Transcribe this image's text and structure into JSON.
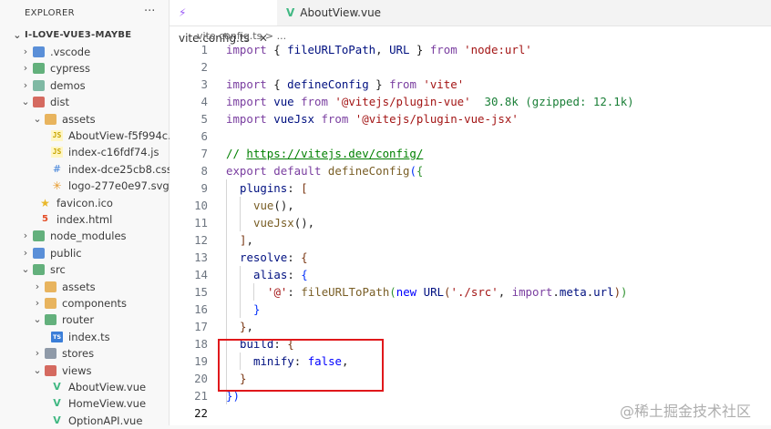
{
  "explorer": {
    "title": "EXPLORER",
    "more": "···",
    "root": "I-LOVE-VUE3-MAYBE",
    "items": [
      {
        "label": ".vscode",
        "type": "folder",
        "color": "blue",
        "chev": "›"
      },
      {
        "label": "cypress",
        "type": "folder",
        "color": "green",
        "chev": "›"
      },
      {
        "label": "demos",
        "type": "folder",
        "color": "teal",
        "chev": "›"
      },
      {
        "label": "dist",
        "type": "folder",
        "color": "red",
        "chev": "⌄"
      },
      {
        "label": "assets",
        "type": "folder",
        "color": "yellow",
        "chev": "⌄"
      },
      {
        "label": "AboutView-f5f994c...",
        "type": "js"
      },
      {
        "label": "index-c16fdf74.js",
        "type": "js"
      },
      {
        "label": "index-dce25cb8.css",
        "type": "css"
      },
      {
        "label": "logo-277e0e97.svg",
        "type": "svg"
      },
      {
        "label": "favicon.ico",
        "type": "ico"
      },
      {
        "label": "index.html",
        "type": "html"
      },
      {
        "label": "node_modules",
        "type": "folder",
        "color": "green",
        "chev": "›"
      },
      {
        "label": "public",
        "type": "folder",
        "color": "blue",
        "chev": "›"
      },
      {
        "label": "src",
        "type": "folder",
        "color": "green",
        "chev": "⌄"
      },
      {
        "label": "assets",
        "type": "folder",
        "color": "yellow",
        "chev": "›"
      },
      {
        "label": "components",
        "type": "folder",
        "color": "yellow",
        "chev": "›"
      },
      {
        "label": "router",
        "type": "folder",
        "color": "green",
        "chev": "⌄"
      },
      {
        "label": "index.ts",
        "type": "ts"
      },
      {
        "label": "stores",
        "type": "folder",
        "color": "grey",
        "chev": "›"
      },
      {
        "label": "views",
        "type": "folder",
        "color": "red",
        "chev": "⌄"
      },
      {
        "label": "AboutView.vue",
        "type": "vue"
      },
      {
        "label": "HomeView.vue",
        "type": "vue"
      },
      {
        "label": "OptionAPI.vue",
        "type": "vue"
      }
    ]
  },
  "tabs": [
    {
      "label": "vite.config.ts",
      "close": "✕",
      "icon": "vite-icon"
    },
    {
      "label": "AboutView.vue",
      "icon": "vue-icon"
    }
  ],
  "breadcrumb": {
    "file": "vite.config.ts",
    "sep": ">",
    "rest": "..."
  },
  "code": {
    "l1": {
      "n": "1",
      "a": "import",
      "b": " { ",
      "c": "fileURLToPath",
      "d": ", ",
      "e": "URL",
      "f": " } ",
      "g": "from",
      "h": " ",
      "i": "'node:url'"
    },
    "l3": {
      "n": "3",
      "a": "import",
      "b": " { ",
      "c": "defineConfig",
      "d": " } ",
      "e": "from",
      "f": " ",
      "g": "'vite'"
    },
    "l4": {
      "n": "4",
      "a": "import",
      "b": " ",
      "c": "vue",
      "d": " ",
      "e": "from",
      "f": " ",
      "g": "'@vitejs/plugin-vue'",
      "h": "  30.8k (gzipped: 12.1k)"
    },
    "l5": {
      "n": "5",
      "a": "import",
      "b": " ",
      "c": "vueJsx",
      "d": " ",
      "e": "from",
      "f": " ",
      "g": "'@vitejs/plugin-vue-jsx'"
    },
    "l7": {
      "n": "7",
      "a": "// ",
      "b": "https://vitejs.dev/config/"
    },
    "l8": {
      "n": "8",
      "a": "export",
      "b": " ",
      "c": "default",
      "d": " ",
      "e": "defineConfig",
      "f": "(",
      "g": "{"
    },
    "l9": {
      "n": "9",
      "a": "plugins",
      "b": ": ",
      "c": "["
    },
    "l10": {
      "n": "10",
      "a": "vue",
      "b": "(),"
    },
    "l11": {
      "n": "11",
      "a": "vueJsx",
      "b": "(),"
    },
    "l12": {
      "n": "12",
      "a": "]",
      "b": ","
    },
    "l13": {
      "n": "13",
      "a": "resolve",
      "b": ": ",
      "c": "{"
    },
    "l14": {
      "n": "14",
      "a": "alias",
      "b": ": ",
      "c": "{"
    },
    "l15": {
      "n": "15",
      "a": "'@'",
      "b": ": ",
      "c": "fileURLToPath",
      "d": "(",
      "e": "new",
      "f": " ",
      "g": "URL",
      "h": "(",
      "i": "'./src'",
      "j": ", ",
      "k": "import",
      "l": ".",
      "m": "meta",
      "o": ".",
      "p": "url",
      "q": ")",
      "r": ")"
    },
    "l16": {
      "n": "16",
      "a": "}"
    },
    "l17": {
      "n": "17",
      "a": "}",
      "b": ","
    },
    "l18": {
      "n": "18",
      "a": "build",
      "b": ": ",
      "c": "{"
    },
    "l19": {
      "n": "19",
      "a": "minify",
      "b": ": ",
      "c": "false",
      "d": ","
    },
    "l20": {
      "n": "20",
      "a": "}"
    },
    "l21": {
      "n": "21",
      "a": "})"
    },
    "l22": {
      "n": "22"
    },
    "l2": {
      "n": "2"
    },
    "l6": {
      "n": "6"
    }
  },
  "watermark": "@稀土掘金技术社区",
  "colors": {
    "highlight_box": "#e0181b",
    "accent": "#0431fa"
  }
}
